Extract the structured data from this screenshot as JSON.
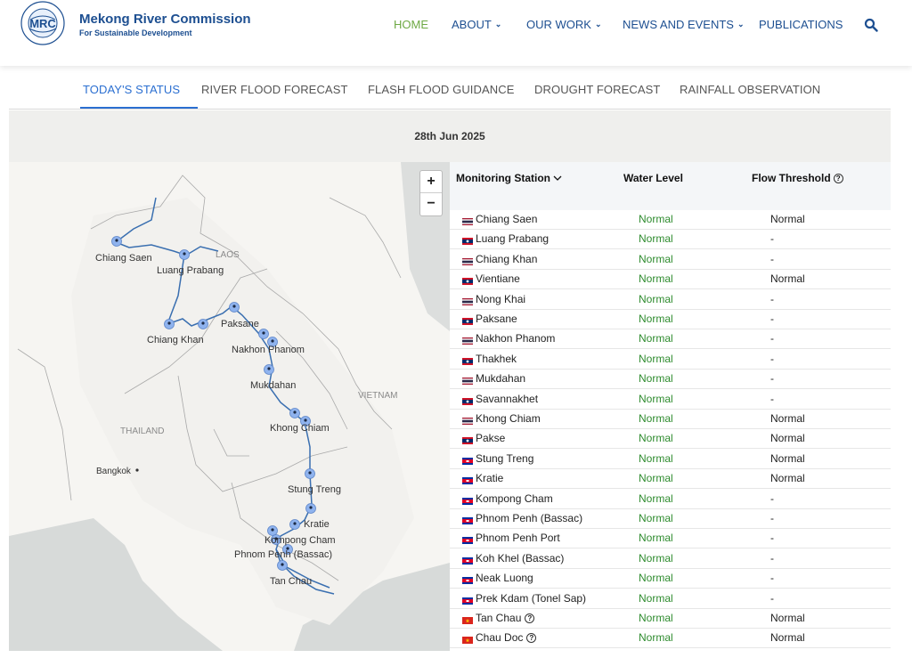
{
  "brand": {
    "title": "Mekong River Commission",
    "subtitle": "For Sustainable Development",
    "logo_text": "MRC",
    "logo_ring": "MEKONG RIVER COMMISSION · FOR SUSTAINABLE DEVELOPMENT"
  },
  "nav": {
    "home": "HOME",
    "about": "ABOUT",
    "our_work": "OUR WORK",
    "news": "NEWS AND EVENTS",
    "publications": "PUBLICATIONS"
  },
  "tabs": [
    "TODAY'S STATUS",
    "RIVER FLOOD FORECAST",
    "FLASH FLOOD GUIDANCE",
    "DROUGHT FORECAST",
    "RAINFALL OBSERVATION"
  ],
  "date": "28th Jun 2025",
  "map": {
    "zoom_in": "+",
    "zoom_out": "−",
    "country_labels": [
      "LAOS",
      "THAILAND",
      "VIETNAM"
    ],
    "city_label": "Bangkok",
    "station_labels": [
      "Chiang Saen",
      "Luang Prabang",
      "Chiang Khan",
      "Paksane",
      "Nakhon Phanom",
      "Mukdahan",
      "Khong Chiam",
      "Stung Treng",
      "Kratie",
      "Kompong Cham",
      "Phnom Penh (Bassac)",
      "Tan Chau"
    ]
  },
  "table": {
    "headers": {
      "station": "Monitoring Station",
      "water_level": "Water Level",
      "flow_threshold": "Flow Threshold"
    },
    "rows": [
      {
        "country": "TH",
        "station": "Chiang Saen",
        "water_level": "Normal",
        "flow": "Normal",
        "help": false
      },
      {
        "country": "LA",
        "station": "Luang Prabang",
        "water_level": "Normal",
        "flow": "-",
        "help": false
      },
      {
        "country": "TH",
        "station": "Chiang Khan",
        "water_level": "Normal",
        "flow": "-",
        "help": false
      },
      {
        "country": "LA",
        "station": "Vientiane",
        "water_level": "Normal",
        "flow": "Normal",
        "help": false
      },
      {
        "country": "TH",
        "station": "Nong Khai",
        "water_level": "Normal",
        "flow": "-",
        "help": false
      },
      {
        "country": "LA",
        "station": "Paksane",
        "water_level": "Normal",
        "flow": "-",
        "help": false
      },
      {
        "country": "TH",
        "station": "Nakhon Phanom",
        "water_level": "Normal",
        "flow": "-",
        "help": false
      },
      {
        "country": "LA",
        "station": "Thakhek",
        "water_level": "Normal",
        "flow": "-",
        "help": false
      },
      {
        "country": "TH",
        "station": "Mukdahan",
        "water_level": "Normal",
        "flow": "-",
        "help": false
      },
      {
        "country": "LA",
        "station": "Savannakhet",
        "water_level": "Normal",
        "flow": "-",
        "help": false
      },
      {
        "country": "TH",
        "station": "Khong Chiam",
        "water_level": "Normal",
        "flow": "Normal",
        "help": false
      },
      {
        "country": "LA",
        "station": "Pakse",
        "water_level": "Normal",
        "flow": "Normal",
        "help": false
      },
      {
        "country": "KH",
        "station": "Stung Treng",
        "water_level": "Normal",
        "flow": "Normal",
        "help": false
      },
      {
        "country": "KH",
        "station": "Kratie",
        "water_level": "Normal",
        "flow": "Normal",
        "help": false
      },
      {
        "country": "KH",
        "station": "Kompong Cham",
        "water_level": "Normal",
        "flow": "-",
        "help": false
      },
      {
        "country": "KH",
        "station": "Phnom Penh (Bassac)",
        "water_level": "Normal",
        "flow": "-",
        "help": false
      },
      {
        "country": "KH",
        "station": "Phnom Penh Port",
        "water_level": "Normal",
        "flow": "-",
        "help": false
      },
      {
        "country": "KH",
        "station": "Koh Khel (Bassac)",
        "water_level": "Normal",
        "flow": "-",
        "help": false
      },
      {
        "country": "KH",
        "station": "Neak Luong",
        "water_level": "Normal",
        "flow": "-",
        "help": false
      },
      {
        "country": "KH",
        "station": "Prek Kdam (Tonel Sap)",
        "water_level": "Normal",
        "flow": "-",
        "help": false
      },
      {
        "country": "VN",
        "station": "Tan Chau",
        "water_level": "Normal",
        "flow": "Normal",
        "help": true
      },
      {
        "country": "VN",
        "station": "Chau Doc",
        "water_level": "Normal",
        "flow": "Normal",
        "help": true
      }
    ]
  },
  "colors": {
    "brand_blue": "#1d4f91",
    "home_green": "#6ea944",
    "tab_active": "#2b6fd1",
    "status_green": "#2e8b2e",
    "river": "#3a6fb0",
    "marker": "#8fb3ee"
  }
}
